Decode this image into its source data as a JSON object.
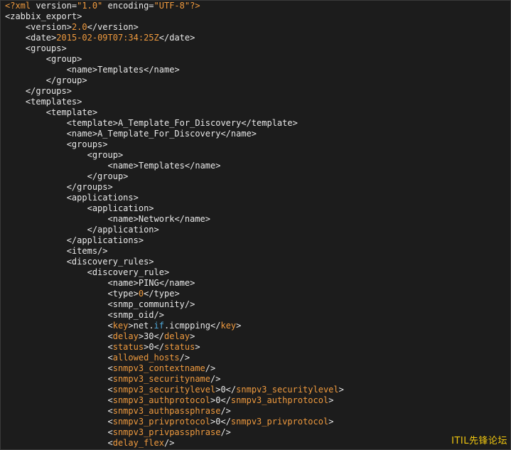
{
  "watermark": "ITIL先锋论坛",
  "lines": [
    {
      "indent": 0,
      "segs": [
        {
          "c": "o",
          "t": "<?xml "
        },
        {
          "c": "t",
          "t": "version="
        },
        {
          "c": "s",
          "t": "\"1.0\""
        },
        {
          "c": "t",
          "t": " encoding="
        },
        {
          "c": "s",
          "t": "\"UTF-8\""
        },
        {
          "c": "o",
          "t": "?>"
        }
      ]
    },
    {
      "indent": 0,
      "segs": [
        {
          "c": "t",
          "t": "<zabbix_export>"
        }
      ]
    },
    {
      "indent": 1,
      "segs": [
        {
          "c": "t",
          "t": "<version>"
        },
        {
          "c": "o",
          "t": "2.0"
        },
        {
          "c": "t",
          "t": "</version>"
        }
      ]
    },
    {
      "indent": 1,
      "segs": [
        {
          "c": "t",
          "t": "<date>"
        },
        {
          "c": "o",
          "t": "2015-02-09T07:34:25Z"
        },
        {
          "c": "t",
          "t": "</date>"
        }
      ]
    },
    {
      "indent": 1,
      "segs": [
        {
          "c": "t",
          "t": "<groups>"
        }
      ]
    },
    {
      "indent": 2,
      "segs": [
        {
          "c": "t",
          "t": "<group>"
        }
      ]
    },
    {
      "indent": 3,
      "segs": [
        {
          "c": "t",
          "t": "<name>"
        },
        {
          "c": "v",
          "t": "Templates"
        },
        {
          "c": "t",
          "t": "</name>"
        }
      ]
    },
    {
      "indent": 2,
      "segs": [
        {
          "c": "t",
          "t": "</group>"
        }
      ]
    },
    {
      "indent": 1,
      "segs": [
        {
          "c": "t",
          "t": "</groups>"
        }
      ]
    },
    {
      "indent": 1,
      "segs": [
        {
          "c": "t",
          "t": "<templates>"
        }
      ]
    },
    {
      "indent": 2,
      "segs": [
        {
          "c": "t",
          "t": "<template>"
        }
      ]
    },
    {
      "indent": 3,
      "segs": [
        {
          "c": "t",
          "t": "<template>"
        },
        {
          "c": "v",
          "t": "A_Template_For_Discovery"
        },
        {
          "c": "t",
          "t": "</template>"
        }
      ]
    },
    {
      "indent": 3,
      "segs": [
        {
          "c": "t",
          "t": "<name>"
        },
        {
          "c": "v",
          "t": "A_Template_For_Discovery"
        },
        {
          "c": "t",
          "t": "</name>"
        }
      ]
    },
    {
      "indent": 3,
      "segs": [
        {
          "c": "t",
          "t": "<groups>"
        }
      ]
    },
    {
      "indent": 4,
      "segs": [
        {
          "c": "t",
          "t": "<group>"
        }
      ]
    },
    {
      "indent": 5,
      "segs": [
        {
          "c": "t",
          "t": "<name>"
        },
        {
          "c": "v",
          "t": "Templates"
        },
        {
          "c": "t",
          "t": "</name>"
        }
      ]
    },
    {
      "indent": 4,
      "segs": [
        {
          "c": "t",
          "t": "</group>"
        }
      ]
    },
    {
      "indent": 3,
      "segs": [
        {
          "c": "t",
          "t": "</groups>"
        }
      ]
    },
    {
      "indent": 3,
      "segs": [
        {
          "c": "t",
          "t": "<applications>"
        }
      ]
    },
    {
      "indent": 4,
      "segs": [
        {
          "c": "t",
          "t": "<application>"
        }
      ]
    },
    {
      "indent": 5,
      "segs": [
        {
          "c": "t",
          "t": "<name>"
        },
        {
          "c": "v",
          "t": "Network"
        },
        {
          "c": "t",
          "t": "</name>"
        }
      ]
    },
    {
      "indent": 4,
      "segs": [
        {
          "c": "t",
          "t": "</application>"
        }
      ]
    },
    {
      "indent": 3,
      "segs": [
        {
          "c": "t",
          "t": "</applications>"
        }
      ]
    },
    {
      "indent": 3,
      "segs": [
        {
          "c": "t",
          "t": "<items/>"
        }
      ]
    },
    {
      "indent": 3,
      "segs": [
        {
          "c": "t",
          "t": "<discovery_rules>"
        }
      ]
    },
    {
      "indent": 4,
      "segs": [
        {
          "c": "t",
          "t": "<discovery_rule>"
        }
      ]
    },
    {
      "indent": 5,
      "segs": [
        {
          "c": "t",
          "t": "<name>"
        },
        {
          "c": "v",
          "t": "PING"
        },
        {
          "c": "t",
          "t": "</name>"
        }
      ]
    },
    {
      "indent": 5,
      "segs": [
        {
          "c": "t",
          "t": "<type>"
        },
        {
          "c": "o",
          "t": "0"
        },
        {
          "c": "t",
          "t": "</type>"
        }
      ]
    },
    {
      "indent": 5,
      "segs": [
        {
          "c": "t",
          "t": "<snmp_community/>"
        }
      ]
    },
    {
      "indent": 5,
      "segs": [
        {
          "c": "t",
          "t": "<snmp_oid/>"
        }
      ]
    },
    {
      "indent": 5,
      "segs": [
        {
          "c": "t",
          "t": "<"
        },
        {
          "c": "o",
          "t": "key"
        },
        {
          "c": "t",
          "t": ">net."
        },
        {
          "c": "k",
          "t": "if"
        },
        {
          "c": "t",
          "t": ".icmpping</"
        },
        {
          "c": "o",
          "t": "key"
        },
        {
          "c": "t",
          "t": ">"
        }
      ]
    },
    {
      "indent": 5,
      "segs": [
        {
          "c": "t",
          "t": "<"
        },
        {
          "c": "o",
          "t": "delay"
        },
        {
          "c": "t",
          "t": ">30</"
        },
        {
          "c": "o",
          "t": "delay"
        },
        {
          "c": "t",
          "t": ">"
        }
      ]
    },
    {
      "indent": 5,
      "segs": [
        {
          "c": "t",
          "t": "<"
        },
        {
          "c": "o",
          "t": "status"
        },
        {
          "c": "t",
          "t": ">0</"
        },
        {
          "c": "o",
          "t": "status"
        },
        {
          "c": "t",
          "t": ">"
        }
      ]
    },
    {
      "indent": 5,
      "segs": [
        {
          "c": "t",
          "t": "<"
        },
        {
          "c": "o",
          "t": "allowed_hosts"
        },
        {
          "c": "t",
          "t": "/>"
        }
      ]
    },
    {
      "indent": 5,
      "segs": [
        {
          "c": "t",
          "t": "<"
        },
        {
          "c": "o",
          "t": "snmpv3_contextname"
        },
        {
          "c": "t",
          "t": "/>"
        }
      ]
    },
    {
      "indent": 5,
      "segs": [
        {
          "c": "t",
          "t": "<"
        },
        {
          "c": "o",
          "t": "snmpv3_securityname"
        },
        {
          "c": "t",
          "t": "/>"
        }
      ]
    },
    {
      "indent": 5,
      "segs": [
        {
          "c": "t",
          "t": "<"
        },
        {
          "c": "o",
          "t": "snmpv3_securitylevel"
        },
        {
          "c": "t",
          "t": ">0</"
        },
        {
          "c": "o",
          "t": "snmpv3_securitylevel"
        },
        {
          "c": "t",
          "t": ">"
        }
      ]
    },
    {
      "indent": 5,
      "segs": [
        {
          "c": "t",
          "t": "<"
        },
        {
          "c": "o",
          "t": "snmpv3_authprotocol"
        },
        {
          "c": "t",
          "t": ">0</"
        },
        {
          "c": "o",
          "t": "snmpv3_authprotocol"
        },
        {
          "c": "t",
          "t": ">"
        }
      ]
    },
    {
      "indent": 5,
      "segs": [
        {
          "c": "t",
          "t": "<"
        },
        {
          "c": "o",
          "t": "snmpv3_authpassphrase"
        },
        {
          "c": "t",
          "t": "/>"
        }
      ]
    },
    {
      "indent": 5,
      "segs": [
        {
          "c": "t",
          "t": "<"
        },
        {
          "c": "o",
          "t": "snmpv3_privprotocol"
        },
        {
          "c": "t",
          "t": ">0</"
        },
        {
          "c": "o",
          "t": "snmpv3_privprotocol"
        },
        {
          "c": "t",
          "t": ">"
        }
      ]
    },
    {
      "indent": 5,
      "segs": [
        {
          "c": "t",
          "t": "<"
        },
        {
          "c": "o",
          "t": "snmpv3_privpassphrase"
        },
        {
          "c": "t",
          "t": "/>"
        }
      ]
    },
    {
      "indent": 5,
      "segs": [
        {
          "c": "t",
          "t": "<"
        },
        {
          "c": "o",
          "t": "delay_flex"
        },
        {
          "c": "t",
          "t": "/>"
        }
      ]
    }
  ]
}
